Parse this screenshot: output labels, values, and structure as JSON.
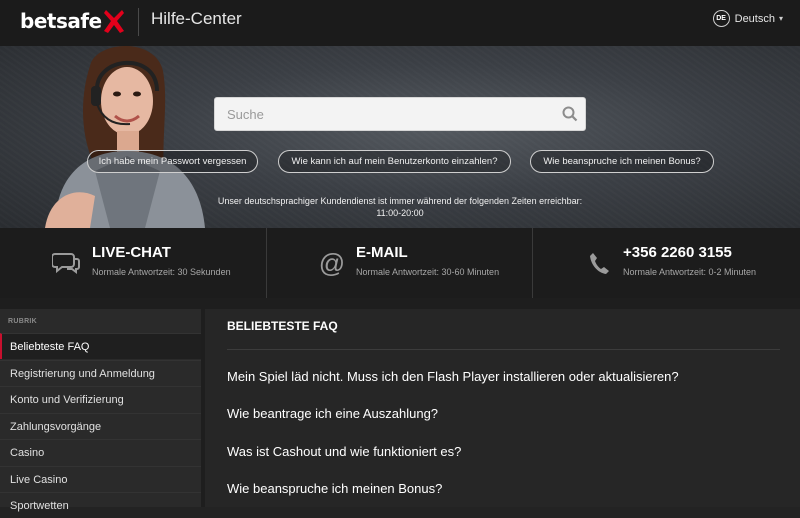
{
  "header": {
    "logo_text": "betsafe",
    "title": "Hilfe-Center",
    "lang_badge": "DE",
    "lang_label": "Deutsch"
  },
  "hero": {
    "search_placeholder": "Suche",
    "quick_links": [
      "Ich habe mein Passwort vergessen",
      "Wie kann ich auf mein Benutzerkonto einzahlen?",
      "Wie beanspruche ich meinen Bonus?"
    ],
    "hours_text": "Unser deutschsprachiger Kundendienst ist immer während der folgenden Zeiten erreichbar:",
    "hours_value": "11:00-20:00"
  },
  "contact": [
    {
      "icon": "chat-icon",
      "title": "LIVE-CHAT",
      "subtitle": "Normale Antwortzeit: 30 Sekunden"
    },
    {
      "icon": "at-icon",
      "title": "E-MAIL",
      "subtitle": "Normale Antwortzeit: 30-60 Minuten"
    },
    {
      "icon": "phone-icon",
      "title": "+356 2260 3155",
      "subtitle": "Normale Antwortzeit: 0-2 Minuten"
    }
  ],
  "sidebar": {
    "heading": "RUBRIK",
    "items": [
      "Beliebteste FAQ",
      "Registrierung und Anmeldung",
      "Konto und Verifizierung",
      "Zahlungsvorgänge",
      "Casino",
      "Live Casino",
      "Sportwetten"
    ],
    "active_index": 0
  },
  "faq": {
    "title": "BELIEBTESTE FAQ",
    "questions": [
      "Mein Spiel läd nicht. Muss ich den Flash Player installieren oder aktualisieren?",
      "Wie beantrage ich eine Auszahlung?",
      "Was ist Cashout und wie funktioniert es?",
      "Wie beanspruche ich meinen Bonus?"
    ]
  },
  "colors": {
    "brand_red": "#c8102e",
    "background": "#1e1e1e"
  }
}
